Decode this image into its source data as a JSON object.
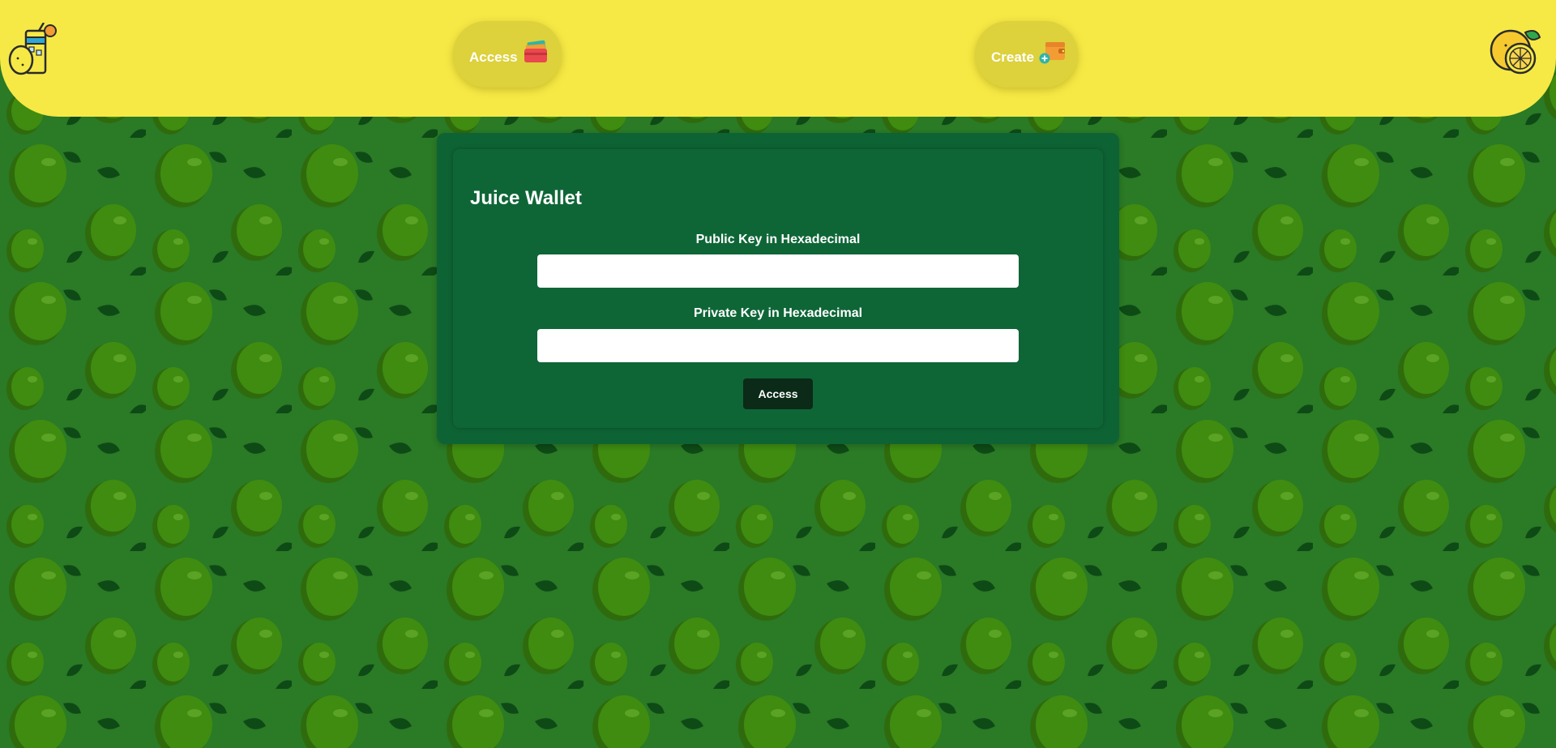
{
  "nav": {
    "access_label": "Access",
    "create_label": "Create"
  },
  "card": {
    "title": "Juice Wallet",
    "public_key_label": "Public Key in Hexadecimal",
    "public_key_value": "",
    "private_key_label": "Private Key in Hexadecimal",
    "private_key_value": "",
    "submit_label": "Access"
  },
  "colors": {
    "navbar": "#f6e945",
    "nav_button": "#ddd13c",
    "background": "#2a7a26",
    "lime": "#3f8c10",
    "card": "#0e6334",
    "submit_button": "#0b2a18"
  },
  "icons": {
    "logo_left": "lemonade-logo-icon",
    "logo_right": "lemon-icon",
    "access": "wallet-cards-icon",
    "create": "wallet-add-icon"
  }
}
